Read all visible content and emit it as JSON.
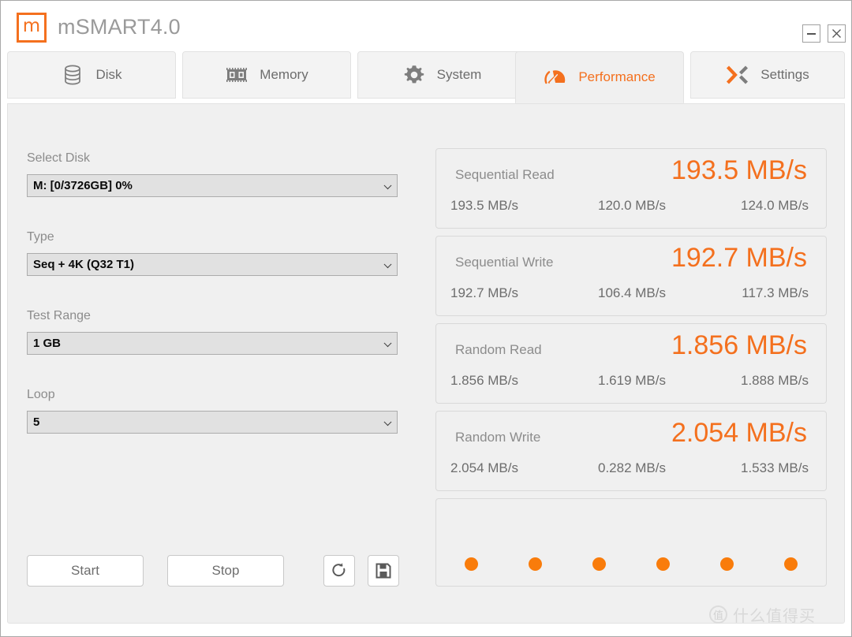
{
  "window": {
    "app_title": "mSMART4.0",
    "logo_glyph": "m",
    "minimize_label": "–",
    "close_label": "✕",
    "accent_color": "#F4701E",
    "dot_color": "#F97C0B"
  },
  "tabs": [
    {
      "id": "disk",
      "label": "Disk",
      "icon": "disk-icon",
      "active": false
    },
    {
      "id": "memory",
      "label": "Memory",
      "icon": "memory-icon",
      "active": false
    },
    {
      "id": "system",
      "label": "System",
      "icon": "gear-icon",
      "active": false
    },
    {
      "id": "performance",
      "label": "Performance",
      "icon": "speedometer-icon",
      "active": true
    },
    {
      "id": "settings",
      "label": "Settings",
      "icon": "x-arrows-icon",
      "active": false
    }
  ],
  "form": {
    "select_disk": {
      "label": "Select Disk",
      "value": "M: [0/3726GB] 0%"
    },
    "type": {
      "label": "Type",
      "value": "Seq + 4K (Q32 T1)"
    },
    "test_range": {
      "label": "Test Range",
      "value": "1 GB"
    },
    "loop": {
      "label": "Loop",
      "value": "5"
    }
  },
  "actions": {
    "start_label": "Start",
    "stop_label": "Stop",
    "refresh_icon": "refresh-icon",
    "save_icon": "save-icon"
  },
  "results": [
    {
      "name": "Sequential Read",
      "headline": "193.5 MB/s",
      "runs": [
        "193.5 MB/s",
        "120.0 MB/s",
        "124.0 MB/s"
      ]
    },
    {
      "name": "Sequential Write",
      "headline": "192.7 MB/s",
      "runs": [
        "192.7 MB/s",
        "106.4 MB/s",
        "117.3 MB/s"
      ]
    },
    {
      "name": "Random Read",
      "headline": "1.856 MB/s",
      "runs": [
        "1.856 MB/s",
        "1.619 MB/s",
        "1.888 MB/s"
      ]
    },
    {
      "name": "Random Write",
      "headline": "2.054 MB/s",
      "runs": [
        "2.054 MB/s",
        "0.282 MB/s",
        "1.533 MB/s"
      ]
    }
  ],
  "progress_dots": {
    "count": 6,
    "color": "#F97C0B"
  },
  "watermark": {
    "badge": "值",
    "text": "什么值得买"
  }
}
